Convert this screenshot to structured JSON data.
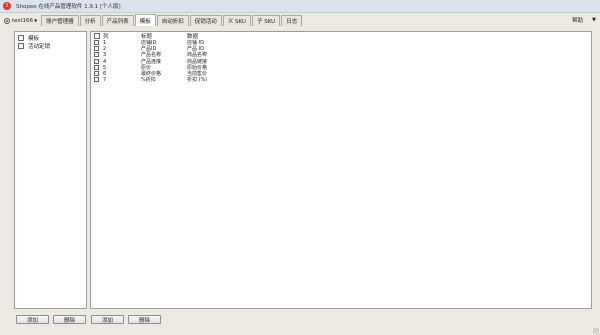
{
  "window": {
    "title": "Shopee 在线产品管理软件 1.9.1 [个人版]",
    "app_icon_glyph": "!"
  },
  "user_menu": {
    "label": "test166"
  },
  "tabs": [
    {
      "label": "账户管理器",
      "active": false
    },
    {
      "label": "分析",
      "active": false
    },
    {
      "label": "产品列表",
      "active": false
    },
    {
      "label": "模板",
      "active": true
    },
    {
      "label": "自动折扣",
      "active": false
    },
    {
      "label": "促销活动",
      "active": false
    },
    {
      "label": "义 SKU",
      "active": false
    },
    {
      "label": "子 SKU",
      "active": false
    },
    {
      "label": "日志",
      "active": false
    }
  ],
  "help": {
    "label": "帮助"
  },
  "left_tree": {
    "items": [
      {
        "label": "模板"
      },
      {
        "label": "活动定销"
      }
    ]
  },
  "grid": {
    "headers": {
      "col": "列",
      "title": "标题",
      "data": "数据"
    },
    "rows": [
      {
        "col": "1",
        "title": "店铺ID",
        "data": "店铺 ID"
      },
      {
        "col": "2",
        "title": "产品ID",
        "data": "产品 ID"
      },
      {
        "col": "3",
        "title": "产品名称",
        "data": "商品名称"
      },
      {
        "col": "4",
        "title": "产品连接",
        "data": "商品链接"
      },
      {
        "col": "5",
        "title": "原价",
        "data": "原始价格"
      },
      {
        "col": "6",
        "title": "最终价格",
        "data": "当前售价"
      },
      {
        "col": "7",
        "title": "%折扣",
        "data": "折扣 (%)"
      }
    ]
  },
  "buttons": {
    "add_left": "添加",
    "delete_left": "删除",
    "add_right": "添加",
    "delete_right": "删除"
  }
}
